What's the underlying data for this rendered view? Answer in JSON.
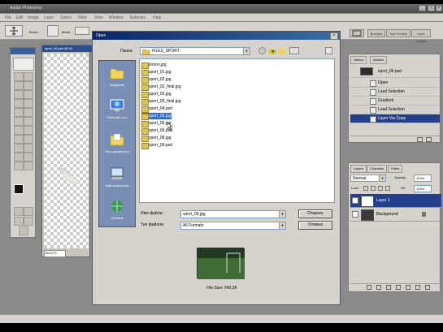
{
  "app": {
    "title": "Adobe Photoshop",
    "window_controls": [
      "_",
      "□",
      "×"
    ]
  },
  "menu": [
    "File",
    "Edit",
    "Image",
    "Layer",
    "Select",
    "Filter",
    "View",
    "Window",
    "Extensis",
    "Help"
  ],
  "options_bar": {
    "mode_label": "Mode:",
    "brush_label": "Brush:",
    "tabs": [
      "Brushes",
      "Tool Presets",
      "Layer Comps"
    ]
  },
  "document": {
    "title": "sport_06.psd @ 66",
    "zoom": "66.67%"
  },
  "open_dialog": {
    "title": "Open",
    "look_in_label": "Папка:",
    "look_in_value": "FILES_SPORT",
    "places": [
      {
        "label": "Недавние",
        "icon": "recent-folder-icon"
      },
      {
        "label": "Рабочий стол",
        "icon": "desktop-icon"
      },
      {
        "label": "Мои документы",
        "icon": "my-documents-icon"
      },
      {
        "label": "Мой компьютер",
        "icon": "my-computer-icon"
      },
      {
        "label": "Сетевое",
        "icon": "network-icon"
      }
    ],
    "files": [
      {
        "name": "kmom.jpg",
        "selected": false
      },
      {
        "name": "sport_01.jpg",
        "selected": false
      },
      {
        "name": "sport_02.jpg",
        "selected": false
      },
      {
        "name": "sport_02_final.jpg",
        "selected": false
      },
      {
        "name": "sport_03.jpg",
        "selected": false
      },
      {
        "name": "sport_03_final.jpg",
        "selected": false
      },
      {
        "name": "sport_04.psd",
        "selected": false
      },
      {
        "name": "sport_05.jpg",
        "selected": true
      },
      {
        "name": "sport_06.jpg",
        "selected": false
      },
      {
        "name": "sport_06.psd",
        "selected": false
      },
      {
        "name": "sport_08.jpg",
        "selected": false
      },
      {
        "name": "sport_09.psd",
        "selected": false
      }
    ],
    "filename_label": "Имя файла:",
    "filename_value": "sport_05.jpg",
    "filetype_label": "Тип файлов:",
    "filetype_value": "All Formats",
    "open_button": "Открыть",
    "cancel_button": "Отмена",
    "file_size": "File Size: 540,3K"
  },
  "history_panel": {
    "tabs": [
      "History",
      "Actions"
    ],
    "snapshot": "sport_06.psd",
    "items": [
      {
        "label": "Open",
        "selected": false
      },
      {
        "label": "Load Selection",
        "selected": false
      },
      {
        "label": "Gradient",
        "selected": false
      },
      {
        "label": "Load Selection",
        "selected": false
      },
      {
        "label": "Layer Via Copy",
        "selected": true
      }
    ]
  },
  "layers_panel": {
    "tabs": [
      "Layers",
      "Channels",
      "Paths"
    ],
    "blend_mode": "Normal",
    "opacity_label": "Opacity:",
    "opacity_value": "100%",
    "lock_label": "Lock:",
    "fill_label": "Fill:",
    "fill_value": "100%",
    "layers": [
      {
        "name": "Layer 1",
        "selected": true
      },
      {
        "name": "Background",
        "selected": false
      }
    ]
  },
  "colors": {
    "dialog_title_start": "#0a246a",
    "dialog_title_end": "#3a6ea5",
    "selection": "#316ac5",
    "panel_selection": "#24408a",
    "panel_bg": "#d6d3ce"
  }
}
